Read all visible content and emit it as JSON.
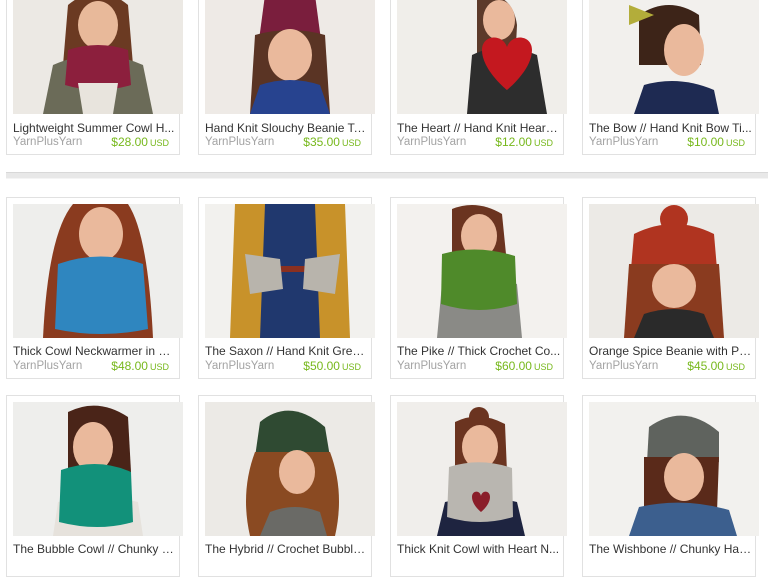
{
  "listings": [
    {
      "title": "Lightweight Summer Cowl H...",
      "shop": "YarnPlusYarn",
      "price": "$28.00",
      "currency": "USD",
      "icon": "cowl-photo"
    },
    {
      "title": "Hand Knit Slouchy Beanie Te...",
      "shop": "YarnPlusYarn",
      "price": "$35.00",
      "currency": "USD",
      "icon": "beanie-photo"
    },
    {
      "title": "The Heart // Hand Knit Heart ...",
      "shop": "YarnPlusYarn",
      "price": "$12.00",
      "currency": "USD",
      "icon": "heart-photo"
    },
    {
      "title": "The Bow // Hand Knit Bow Ti...",
      "shop": "YarnPlusYarn",
      "price": "$10.00",
      "currency": "USD",
      "icon": "bow-photo"
    },
    {
      "title": "Thick Cowl Neckwarmer in D...",
      "shop": "YarnPlusYarn",
      "price": "$48.00",
      "currency": "USD",
      "icon": "cowl-photo"
    },
    {
      "title": "The Saxon // Hand Knit Grey ...",
      "shop": "YarnPlusYarn",
      "price": "$50.00",
      "currency": "USD",
      "icon": "gloves-photo"
    },
    {
      "title": "The Pike // Thick Crochet Co...",
      "shop": "YarnPlusYarn",
      "price": "$60.00",
      "currency": "USD",
      "icon": "cowl-photo"
    },
    {
      "title": "Orange Spice Beanie with Po...",
      "shop": "YarnPlusYarn",
      "price": "$45.00",
      "currency": "USD",
      "icon": "beanie-photo"
    },
    {
      "title": "The Bubble Cowl // Chunky C...",
      "icon": "cowl-photo"
    },
    {
      "title": "The Hybrid // Crochet Bubble...",
      "icon": "beanie-photo"
    },
    {
      "title": "Thick Knit Cowl with Heart N...",
      "icon": "cowl-photo"
    },
    {
      "title": "The Wishbone // Chunky Han...",
      "icon": "beanie-photo"
    }
  ],
  "colors": {
    "price": "#77b81c",
    "shop": "#a3a3a3"
  }
}
